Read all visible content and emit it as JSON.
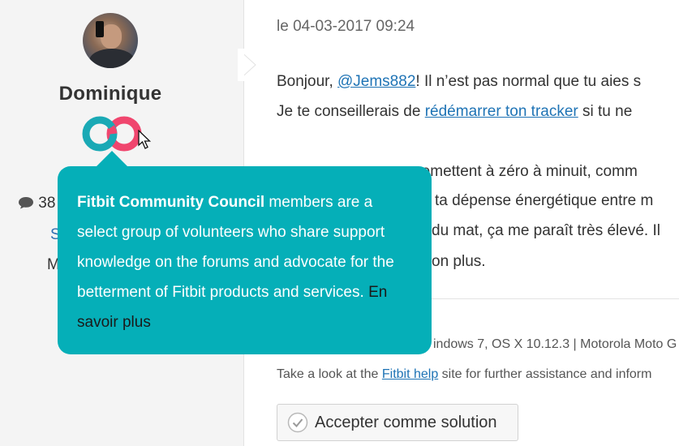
{
  "user": {
    "name": "Dominique",
    "post_count_partial": "38",
    "line2_partial": "S",
    "line3_partial": "M"
  },
  "post": {
    "timestamp": "le 04-03-2017 09:24",
    "line1": {
      "before": "Bonjour, ",
      "mention": "@Jems882",
      "after": "! Il n’est pas normal que tu aies s"
    },
    "line2": {
      "before": "Je te conseillerais de ",
      "link": "rédémarrer ton tracker",
      "after": " si tu ne"
    },
    "line3_partial": "se remettent à zéro à minuit, comm",
    "line4_partial": "ta dépense énergétique entre m",
    "line5_partial": "du mat, ça me paraît très élevé. Il",
    "line6_partial": "on plus.",
    "devices_partial": "indows 7, OS X 10.12.3 | Motorola Moto G",
    "help": {
      "before": "Take a look at the ",
      "link": "Fitbit help",
      "after": " site for further assistance and inform"
    },
    "accept_label": "Accepter comme solution"
  },
  "tooltip": {
    "strong": "Fitbit Community Council",
    "body": " members are a select group of volunteers who share support knowledge on the forums and advocate for the betterment of Fitbit products and services. ",
    "more": "En savoir plus"
  },
  "colors": {
    "badge_teal": "#1aa9b5",
    "badge_pink": "#f0466e",
    "tooltip_bg": "#05afb8",
    "link": "#1e73b5"
  },
  "icons": [
    "speech-bubble-icon",
    "community-council-badge-icon",
    "mouse-cursor-icon",
    "checkmark-circle-icon"
  ]
}
